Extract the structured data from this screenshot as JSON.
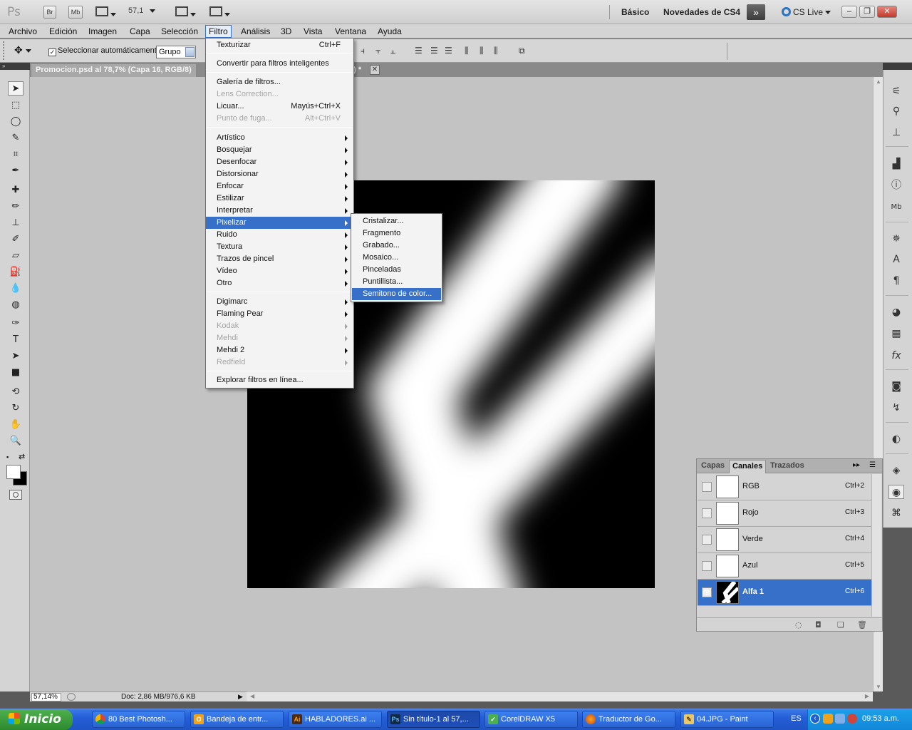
{
  "appbar": {
    "logo": "Ps",
    "btn_br": "Br",
    "btn_mb": "Mb",
    "zoom": "57,1",
    "workspace_basic": "Básico",
    "workspace_cs4": "Novedades de CS4",
    "cs_live": "CS Live"
  },
  "menubar": [
    "Archivo",
    "Edición",
    "Imagen",
    "Capa",
    "Selección",
    "Filtro",
    "Análisis",
    "3D",
    "Vista",
    "Ventana",
    "Ayuda"
  ],
  "options": {
    "auto_select_label": "Seleccionar automáticamente:",
    "auto_select_value": "Grupo"
  },
  "document": {
    "tab_title": "Promocion.psd al 78,7% (Capa 16, RGB/8)",
    "tab_suffix": "8) *"
  },
  "filter_menu": {
    "items": [
      {
        "label": "Texturizar",
        "shortcut": "Ctrl+F"
      },
      {
        "label": "Convertir para filtros inteligentes"
      },
      {
        "label": "Galería de filtros..."
      },
      {
        "label": "Lens Correction...",
        "disabled": true
      },
      {
        "label": "Licuar...",
        "shortcut": "Mayús+Ctrl+X"
      },
      {
        "label": "Punto de fuga...",
        "shortcut": "Alt+Ctrl+V",
        "disabled": true
      },
      {
        "label": "Artístico"
      },
      {
        "label": "Bosquejar"
      },
      {
        "label": "Desenfocar"
      },
      {
        "label": "Distorsionar"
      },
      {
        "label": "Enfocar"
      },
      {
        "label": "Estilizar"
      },
      {
        "label": "Interpretar"
      },
      {
        "label": "Pixelizar"
      },
      {
        "label": "Ruido"
      },
      {
        "label": "Textura"
      },
      {
        "label": "Trazos de pincel"
      },
      {
        "label": "Vídeo"
      },
      {
        "label": "Otro"
      },
      {
        "label": "Digimarc"
      },
      {
        "label": "Flaming Pear"
      },
      {
        "label": "Kodak",
        "disabled": true
      },
      {
        "label": "Mehdi",
        "disabled": true
      },
      {
        "label": "Mehdi 2"
      },
      {
        "label": "Redfield",
        "disabled": true
      },
      {
        "label": "Explorar filtros en línea..."
      }
    ]
  },
  "pixel_submenu": {
    "items": [
      "Cristalizar...",
      "Fragmento",
      "Grabado...",
      "Mosaico...",
      "Pinceladas",
      "Puntillista...",
      "Semitono de color..."
    ]
  },
  "channels_panel": {
    "tabs": [
      "Capas",
      "Canales",
      "Trazados"
    ],
    "channels": [
      {
        "name": "RGB",
        "shortcut": "Ctrl+2"
      },
      {
        "name": "Rojo",
        "shortcut": "Ctrl+3"
      },
      {
        "name": "Verde",
        "shortcut": "Ctrl+4"
      },
      {
        "name": "Azul",
        "shortcut": "Ctrl+5"
      },
      {
        "name": "Alfa 1",
        "shortcut": "Ctrl+6"
      }
    ]
  },
  "status": {
    "zoom": "57,14%",
    "doc_size": "Doc: 2,86 MB/976,6 KB"
  },
  "taskbar": {
    "start": "Inicio",
    "tasks": [
      {
        "label": "80 Best Photosh..."
      },
      {
        "label": "Bandeja de entr..."
      },
      {
        "label": "HABLADORES.ai ..."
      },
      {
        "label": "Sin título-1 al 57,..."
      },
      {
        "label": "CorelDRAW X5"
      },
      {
        "label": "Traductor de Go..."
      },
      {
        "label": "04.JPG - Paint"
      }
    ],
    "lang": "ES",
    "time": "09:53 a.m."
  },
  "colors": {
    "highlight": "#3670c8",
    "taskbar": "#245ed8",
    "canvas_bg": "#c3c3c3"
  }
}
